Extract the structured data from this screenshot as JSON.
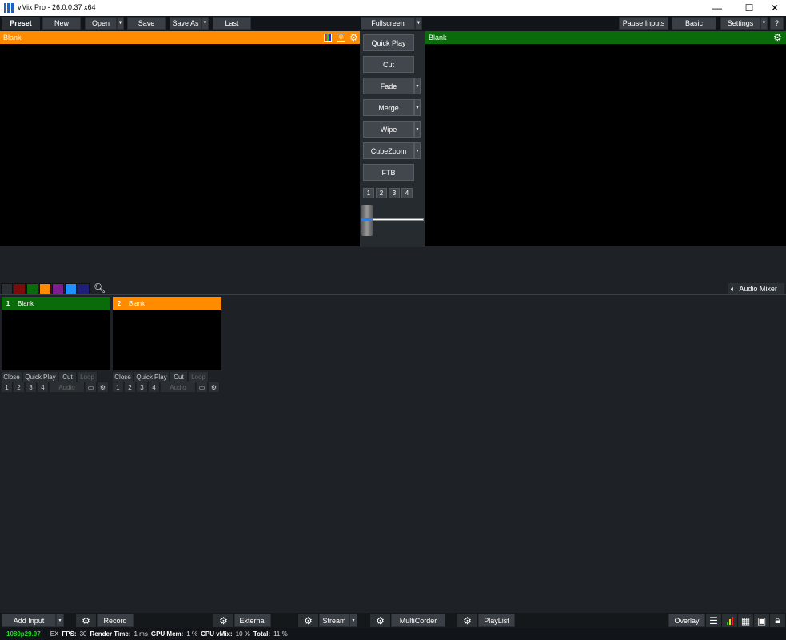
{
  "window": {
    "title": "vMix Pro - 26.0.0.37 x64",
    "minimize": "—",
    "maximize": "☐",
    "close": "✕"
  },
  "toolbar": {
    "preset": "Preset",
    "new": "New",
    "open": "Open",
    "save": "Save",
    "save_as": "Save As",
    "last": "Last",
    "fullscreen": "Fullscreen",
    "pause_inputs": "Pause Inputs",
    "basic": "Basic",
    "settings": "Settings",
    "help": "?"
  },
  "preview": {
    "title": "Blank",
    "color": "#ff8c00"
  },
  "output": {
    "title": "Blank",
    "color": "#0a6b0a"
  },
  "transitions": {
    "quick_play": "Quick Play",
    "cut": "Cut",
    "fade": "Fade",
    "merge": "Merge",
    "wipe": "Wipe",
    "cubezoom": "CubeZoom",
    "ftb": "FTB",
    "numbers": [
      "1",
      "2",
      "3",
      "4"
    ],
    "t_bar_position": 0
  },
  "filter_colors": [
    "#2a2f34",
    "#7a0c0c",
    "#0b6b0b",
    "#ff8c00",
    "#7d1e8f",
    "#1e90ff",
    "#1f1f7a"
  ],
  "audio_mixer": {
    "label": "Audio Mixer"
  },
  "inputs": [
    {
      "number": "1",
      "title": "Blank",
      "color": "#0a6b0a",
      "controls": [
        "Close",
        "Quick Play",
        "Cut",
        "Loop"
      ],
      "nums": [
        "1",
        "2",
        "3",
        "4"
      ],
      "audio": "Audio"
    },
    {
      "number": "2",
      "title": "Blank",
      "color": "#ff8c00",
      "controls": [
        "Close",
        "Quick Play",
        "Cut",
        "Loop"
      ],
      "nums": [
        "1",
        "2",
        "3",
        "4"
      ],
      "audio": "Audio"
    }
  ],
  "bottom": {
    "add_input": "Add Input",
    "record": "Record",
    "external": "External",
    "stream": "Stream",
    "multicorder": "MultiCorder",
    "playlist": "PlayList",
    "overlay": "Overlay"
  },
  "status": {
    "format": "1080p29.97",
    "ex": "EX",
    "fps_label": "FPS:",
    "fps": "30",
    "render_label": "Render Time:",
    "render": "1 ms",
    "gpu_label": "GPU Mem:",
    "gpu": "1 %",
    "cpu_label": "CPU vMix:",
    "cpu": "10 %",
    "total_label": "Total:",
    "total": "11 %",
    "format_color": "#22dd22"
  }
}
